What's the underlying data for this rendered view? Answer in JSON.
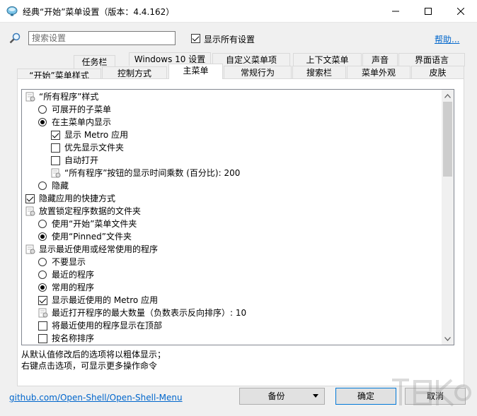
{
  "window": {
    "title": "经典“开始”菜单设置（版本：4.4.162）"
  },
  "search": {
    "placeholder": "搜索设置",
    "value": "",
    "show_all_label": "显示所有设置",
    "show_all_checked": true,
    "help_label": "帮助..."
  },
  "tabs_row1": [
    {
      "label": "“开始”按钮"
    },
    {
      "label": "任务栏"
    },
    {
      "label": "Windows 10 设置"
    },
    {
      "label": "自定义菜单项"
    },
    {
      "label": "上下文菜单"
    },
    {
      "label": "声音"
    },
    {
      "label": "界面语言"
    }
  ],
  "tabs_row2": [
    {
      "label": "“开始”菜单样式"
    },
    {
      "label": "控制方式"
    },
    {
      "label": "主菜单",
      "active": true
    },
    {
      "label": "常规行为"
    },
    {
      "label": "搜索栏"
    },
    {
      "label": "菜单外观"
    },
    {
      "label": "皮肤"
    }
  ],
  "tree": [
    {
      "type": "group",
      "label": "“所有程序”样式"
    },
    {
      "type": "radio",
      "checked": false,
      "label": "可展开的子菜单"
    },
    {
      "type": "radio",
      "checked": true,
      "label": "在主菜单内显示"
    },
    {
      "type": "checkbox",
      "checked": true,
      "label": "显示 Metro 应用"
    },
    {
      "type": "checkbox",
      "checked": false,
      "label": "优先显示文件夹"
    },
    {
      "type": "checkbox",
      "checked": false,
      "label": "自动打开"
    },
    {
      "type": "setting",
      "label": "“所有程序”按钮的显示时间乘数 (百分比): 200"
    },
    {
      "type": "radio",
      "checked": false,
      "label": "隐藏"
    },
    {
      "type": "checkbox",
      "checked": true,
      "label": "隐藏应用的快捷方式"
    },
    {
      "type": "group",
      "label": "放置锁定程序数据的文件夹"
    },
    {
      "type": "radio",
      "checked": false,
      "label": "使用“开始”菜单文件夹"
    },
    {
      "type": "radio",
      "checked": true,
      "label": "使用“Pinned”文件夹"
    },
    {
      "type": "group",
      "label": "显示最近使用或经常使用的程序"
    },
    {
      "type": "radio",
      "checked": false,
      "label": "不要显示"
    },
    {
      "type": "radio",
      "checked": false,
      "label": "最近的程序"
    },
    {
      "type": "radio",
      "checked": true,
      "label": "常用的程序"
    },
    {
      "type": "checkbox",
      "checked": true,
      "label": "显示最近使用的 Metro 应用"
    },
    {
      "type": "setting",
      "label": "最近打开程序的最大数量（负数表示反向排序）: 10"
    },
    {
      "type": "checkbox",
      "checked": false,
      "label": "将最近使用的程序显示在顶部"
    },
    {
      "type": "checkbox",
      "checked": false,
      "label": "按名称排序"
    }
  ],
  "hints": {
    "line1": "从默认值修改后的选项将以粗体显示；",
    "line2": "右键点击选项，可显示更多操作命令"
  },
  "footer": {
    "github_label": "github.com/Open-Shell/Open-Shell-Menu",
    "backup_label": "备份",
    "ok_label": "确定",
    "cancel_label": "取消"
  },
  "colors": {
    "link": "#0066cc",
    "primary_border": "#0078d7"
  }
}
